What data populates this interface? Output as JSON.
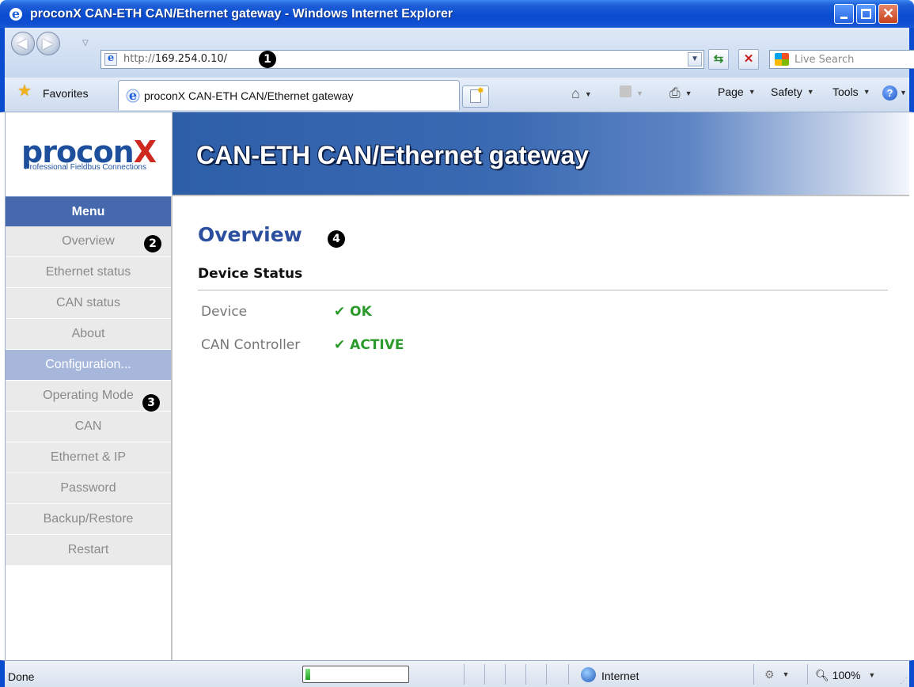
{
  "window": {
    "title": "proconX CAN-ETH CAN/Ethernet gateway - Windows Internet Explorer"
  },
  "address_bar": {
    "protocol": "http://",
    "host": "169.254.0.10/",
    "search_placeholder": "Live Search"
  },
  "favorites_bar": {
    "favorites_label": "Favorites",
    "tab_title": "proconX CAN-ETH CAN/Ethernet gateway"
  },
  "command_bar": {
    "page": "Page",
    "safety": "Safety",
    "tools": "Tools",
    "help_symbol": "?"
  },
  "page": {
    "logo_text_main": "procon",
    "logo_text_x": "X",
    "logo_tagline": "Professional Fieldbus Connections",
    "banner_title": "CAN-ETH CAN/Ethernet gateway",
    "menu_header": "Menu",
    "menu_items": [
      "Overview",
      "Ethernet status",
      "CAN status",
      "About",
      "Configuration...",
      "Operating Mode",
      "CAN",
      "Ethernet & IP",
      "Password",
      "Backup/Restore",
      "Restart"
    ],
    "title": "Overview",
    "section_title": "Device Status",
    "status_rows": [
      {
        "label": "Device",
        "value": "✔ OK"
      },
      {
        "label": "CAN Controller",
        "value": "✔ ACTIVE"
      }
    ]
  },
  "callouts": [
    "1",
    "2",
    "3",
    "4"
  ],
  "status_bar": {
    "text": "Done",
    "progress": 0.05,
    "zone": "Internet",
    "zoom": "100%"
  },
  "colors": {
    "accent_blue": "#2b4f9e",
    "menu_header": "#4569ac",
    "status_ok": "#2a9a2a"
  }
}
